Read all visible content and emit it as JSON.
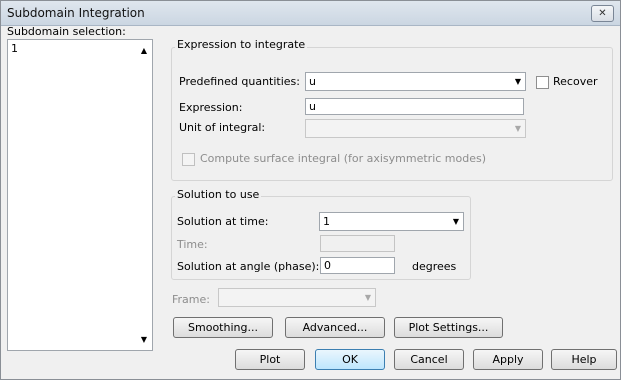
{
  "window": {
    "title": "Subdomain Integration"
  },
  "subdomain": {
    "label": "Subdomain selection:",
    "items": [
      "1"
    ]
  },
  "expression_group": {
    "title": "Expression to integrate",
    "predefined_label": "Predefined quantities:",
    "predefined_value": "u",
    "recover_label": "Recover",
    "expression_label": "Expression:",
    "expression_value": "u",
    "unit_label": "Unit of integral:",
    "unit_value": "",
    "surface_label": "Compute surface integral (for axisymmetric modes)"
  },
  "solution_group": {
    "title": "Solution to use",
    "time_sel_label": "Solution at time:",
    "time_sel_value": "1",
    "time_label": "Time:",
    "time_value": "",
    "angle_label": "Solution at angle (phase):",
    "angle_value": "0",
    "angle_unit": "degrees"
  },
  "frame": {
    "label": "Frame:",
    "value": ""
  },
  "buttons": {
    "smoothing": "Smoothing...",
    "advanced": "Advanced...",
    "plot_settings": "Plot Settings...",
    "plot": "Plot",
    "ok": "OK",
    "cancel": "Cancel",
    "apply": "Apply",
    "help": "Help"
  },
  "icons": {
    "close": "close-icon",
    "dropdown": "chevron-down-icon"
  }
}
